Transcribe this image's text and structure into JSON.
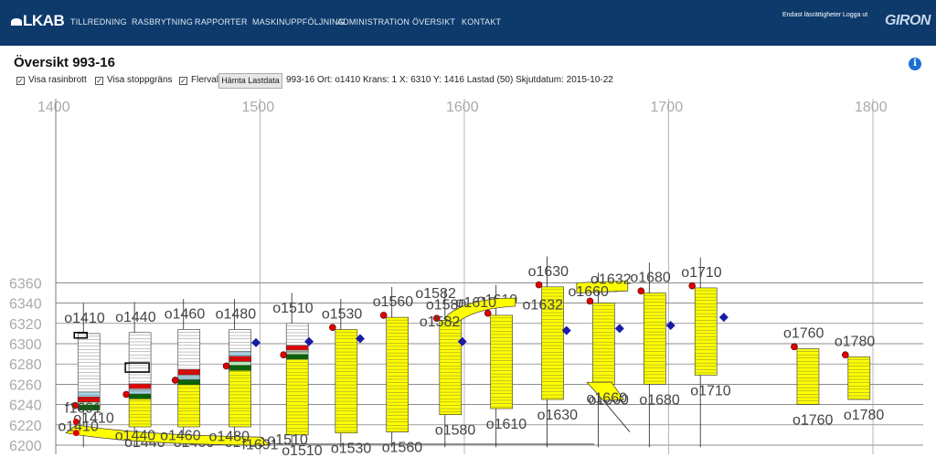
{
  "nav": {
    "logo": "LKAB",
    "menu": [
      "TILLREDNING",
      "RASBRYTNING",
      "RAPPORTER",
      "MASKINUPPFÖLJNING",
      "ADMINISTRATION",
      "ÖVERSIKT",
      "KONTAKT"
    ],
    "readonly_label": "Endast läsrättigheter",
    "logout_label": "Logga ut",
    "brand": "GIRON"
  },
  "page": {
    "title": "Översikt 993-16"
  },
  "controls": {
    "show_rasinbrott": "Visa rasinbrott",
    "show_stoppgrans": "Visa stoppgräns",
    "flerval": "Flerval",
    "fetch_button": "Hämta Lastdata",
    "status": "993-16 Ort: o1410 Krans: 1 X: 6310 Y: 1416 Lastad (50) Skjutdatum: 2015-10-22"
  },
  "colors": {
    "nav": "#0d3a6b",
    "loaded": "#ffff00",
    "red": "#e60000",
    "light_blue": "#a8d4e6",
    "light_green": "#b8e6b8",
    "dark_green": "#006400",
    "marker_red": "#e00000",
    "marker_blue": "#1a1aa8"
  },
  "chart_data": {
    "type": "scatter",
    "x_ticks": [
      1400,
      1500,
      1600,
      1700,
      1800
    ],
    "y_ticks": [
      6200,
      6220,
      6240,
      6260,
      6280,
      6300,
      6320,
      6340,
      6360
    ],
    "xlim": [
      1400,
      1800
    ],
    "ylim": [
      6200,
      6360
    ],
    "grid": true,
    "drifts": [
      {
        "name": "o1410",
        "x": 1418,
        "top": 6310,
        "bottom": 6242,
        "bands": [
          {
            "y": 6250,
            "color": "light_blue"
          },
          {
            "y": 6245,
            "color": "red"
          },
          {
            "y": 6240,
            "color": "light_green"
          },
          {
            "y": 6237,
            "color": "dark_green"
          }
        ]
      },
      {
        "name": "o1440",
        "x": 1443,
        "top": 6311,
        "bottom": 6218,
        "bands": [
          {
            "y": 6258,
            "color": "red"
          },
          {
            "y": 6252,
            "color": "light_blue"
          },
          {
            "y": 6248,
            "color": "dark_green"
          }
        ]
      },
      {
        "name": "o1460",
        "x": 1467,
        "top": 6314,
        "bottom": 6218,
        "bands": [
          {
            "y": 6272,
            "color": "red"
          },
          {
            "y": 6266,
            "color": "light_blue"
          },
          {
            "y": 6262,
            "color": "dark_green"
          }
        ]
      },
      {
        "name": "o1480",
        "x": 1492,
        "top": 6314,
        "bottom": 6218,
        "bands": [
          {
            "y": 6290,
            "color": "light_blue"
          },
          {
            "y": 6285,
            "color": "red"
          },
          {
            "y": 6280,
            "color": "light_green"
          },
          {
            "y": 6276,
            "color": "dark_green"
          }
        ]
      },
      {
        "name": "o1510",
        "x": 1520,
        "top": 6320,
        "bottom": 6210,
        "bands": [
          {
            "y": 6296,
            "color": "red"
          },
          {
            "y": 6290,
            "color": "light_green"
          },
          {
            "y": 6287,
            "color": "dark_green"
          }
        ]
      },
      {
        "name": "o1530",
        "x": 1544,
        "top": 6314,
        "bottom": 6212
      },
      {
        "name": "o1560",
        "x": 1569,
        "top": 6326,
        "bottom": 6213
      },
      {
        "name": "o1580",
        "x": 1595,
        "top": 6323,
        "bottom": 6230
      },
      {
        "name": "o1610",
        "x": 1620,
        "top": 6328,
        "bottom": 6236
      },
      {
        "name": "o1630",
        "x": 1645,
        "top": 6356,
        "bottom": 6245
      },
      {
        "name": "o1660",
        "x": 1670,
        "top": 6340,
        "bottom": 6260
      },
      {
        "name": "o1680",
        "x": 1695,
        "top": 6350,
        "bottom": 6260
      },
      {
        "name": "o1710",
        "x": 1720,
        "top": 6355,
        "bottom": 6269
      },
      {
        "name": "o1760",
        "x": 1770,
        "top": 6295,
        "bottom": 6240
      },
      {
        "name": "o1780",
        "x": 1795,
        "top": 6287,
        "bottom": 6245
      }
    ],
    "labels": [
      "o1410",
      "o1440",
      "o1460",
      "o1480",
      "o1510",
      "o1530",
      "o1560",
      "o1580",
      "o1582",
      "o1582",
      "o1610",
      "o1630",
      "o1632",
      "o1632",
      "o1660",
      "o1660",
      "o1680",
      "o1710",
      "o1710",
      "o1760",
      "o1760",
      "o1780",
      "o1780",
      "o1530",
      "o1560",
      "o1580",
      "o1610",
      "o1630",
      "o1680",
      "f1691",
      "f1691",
      "o1410",
      "o1440",
      "o1460",
      "o1480",
      "o1510"
    ],
    "blue_markers": [
      [
        1498,
        6301
      ],
      [
        1524,
        6302
      ],
      [
        1549,
        6305
      ],
      [
        1599,
        6302
      ],
      [
        1650,
        6313
      ],
      [
        1676,
        6315
      ],
      [
        1701,
        6318
      ],
      [
        1727,
        6326
      ]
    ]
  }
}
